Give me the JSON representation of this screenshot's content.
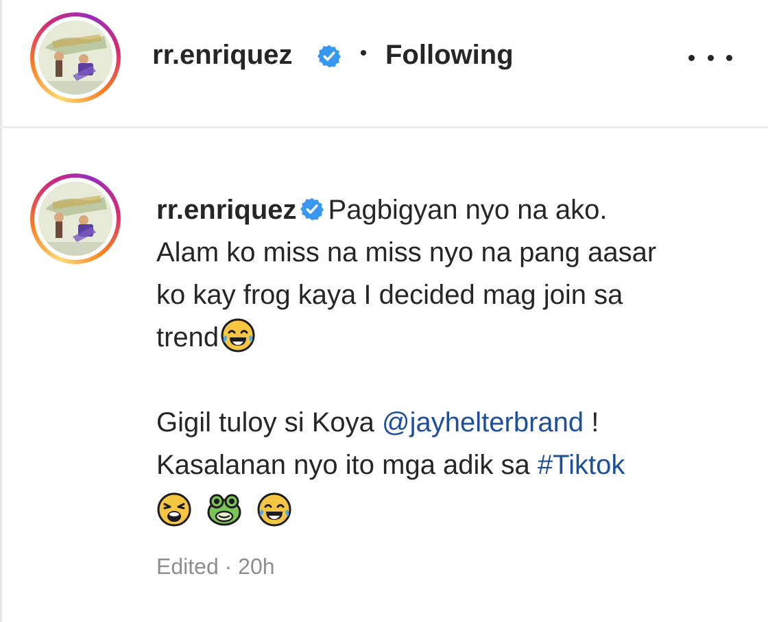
{
  "post": {
    "username": "rr.enriquez",
    "follow_status": "Following"
  },
  "caption": {
    "username": "rr.enriquez",
    "line1": "Pagbigyan nyo na ako.",
    "line2": "Alam ko miss na miss nyo na pang aasar",
    "line3": "ko kay frog kaya I decided mag join sa",
    "line4": "trend",
    "line5_pre": "Gigil tuloy si Koya ",
    "mention": "@jayhelterbrand",
    "line5_post": " !",
    "line6_pre": "Kasalanan nyo ito mga adik sa ",
    "hashtag": "#Tiktok",
    "emojis": [
      "weary-face",
      "frog-face",
      "tears-of-joy"
    ],
    "meta": "Edited · 20h"
  },
  "colors": {
    "verified": "#3897f0",
    "link": "#1f4e9b",
    "muted": "#8e8e8e"
  }
}
